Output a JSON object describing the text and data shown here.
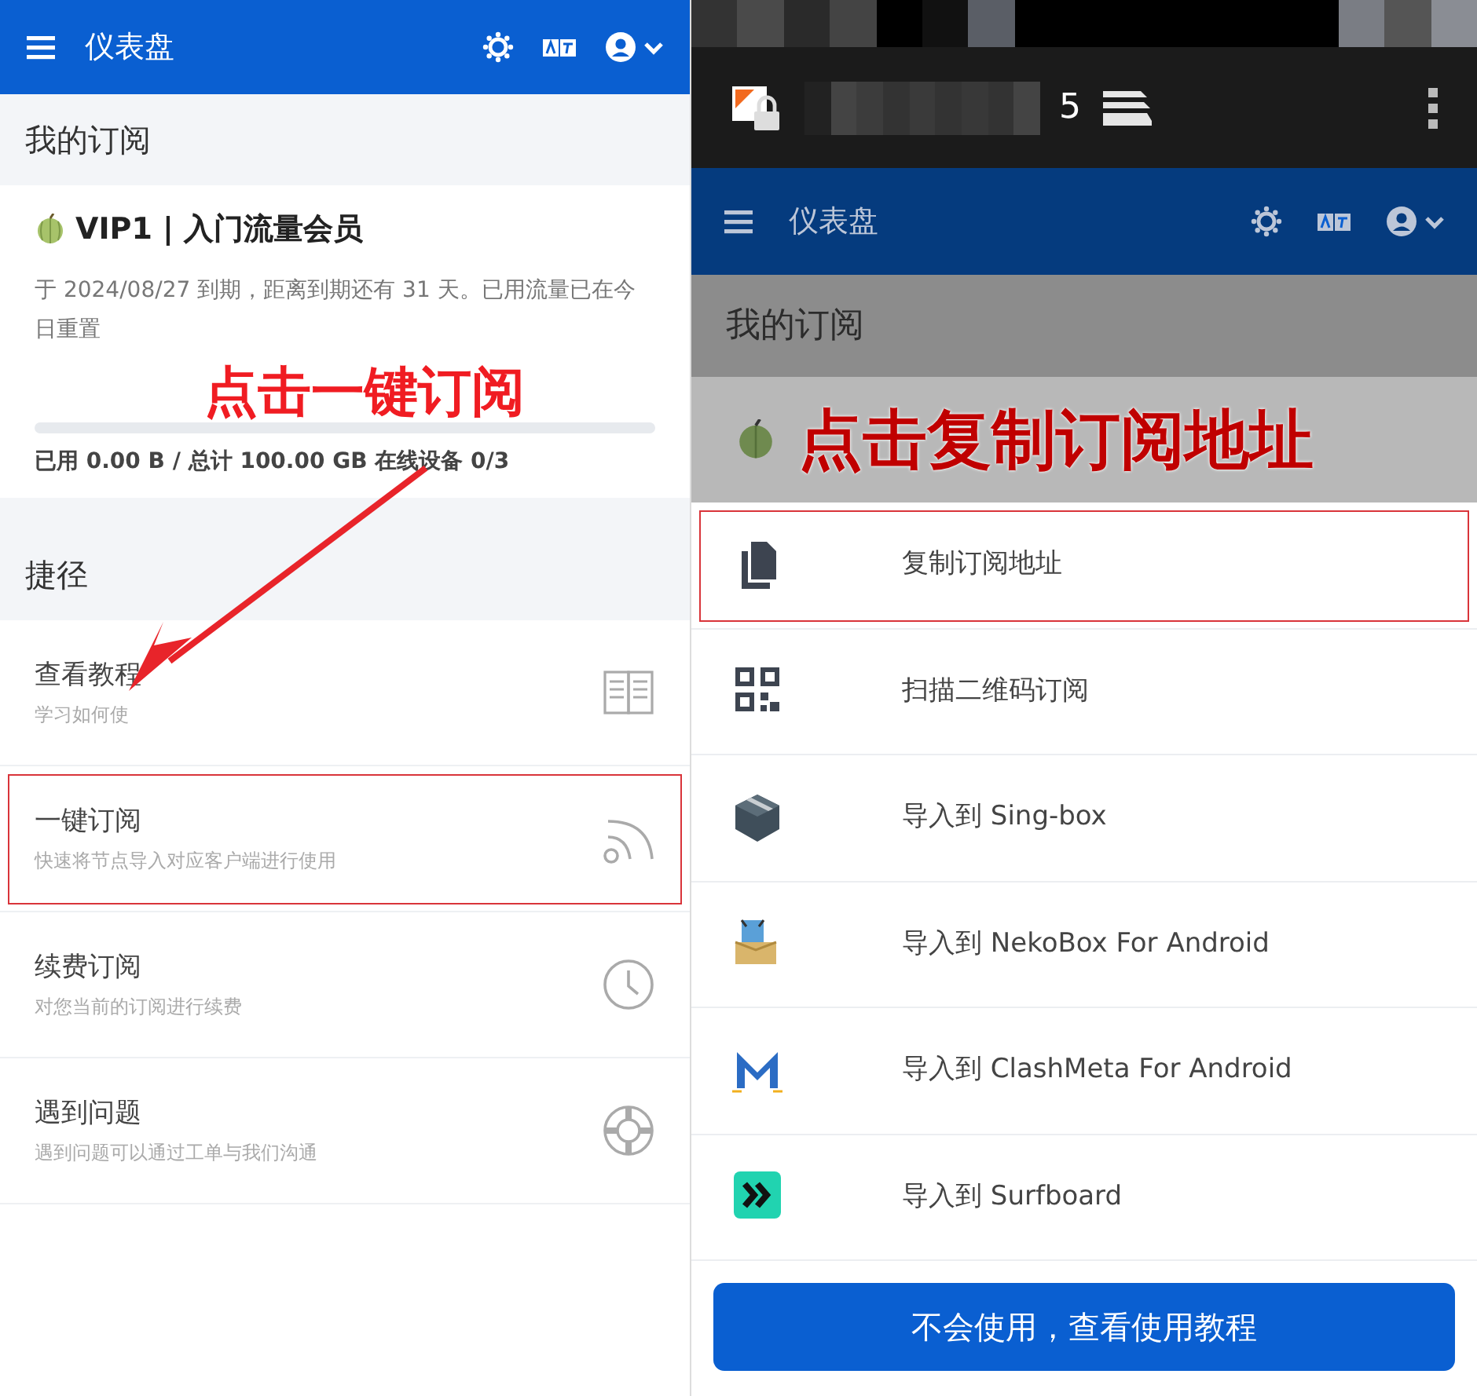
{
  "left_screen": {
    "navbar": {
      "title": "仪表盘"
    },
    "subscription": {
      "header": "我的订阅",
      "plan": "VIP1 | 入门流量会员",
      "description": "于 2024/08/27 到期，距离到期还有 31 天。已用流量已在今日重置",
      "usage": {
        "level": 0
      },
      "stats": "已用 0.00 B / 总计 100.00 GB 在线设备 0/3"
    },
    "shortcuts": {
      "header": "捷径",
      "items": [
        {
          "title": "查看教程",
          "subtitle": "学习如何使",
          "highlighted": false
        },
        {
          "title": "一键订阅",
          "subtitle": "快速将节点导入对应客户端进行使用",
          "highlighted": true
        },
        {
          "title": "续费订阅",
          "subtitle": "对您当前的订阅进行续费",
          "highlighted": false
        },
        {
          "title": "遇到问题",
          "subtitle": "遇到问题可以通过工单与我们沟通",
          "highlighted": false
        }
      ]
    },
    "annotation": "点击一键订阅"
  },
  "right_screen": {
    "browser": {
      "tab_count": "5"
    },
    "navbar": {
      "title": "仪表盘"
    },
    "subscription": {
      "header": "我的订阅"
    },
    "annotation": "点击复制订阅地址",
    "sheet": {
      "items": [
        {
          "label": "复制订阅地址",
          "highlighted": true
        },
        {
          "label": "扫描二维码订阅",
          "highlighted": false
        },
        {
          "label": "导入到 Sing-box",
          "highlighted": false
        },
        {
          "label": "导入到 NekoBox For Android",
          "highlighted": false
        },
        {
          "label": "导入到 ClashMeta For Android",
          "highlighted": false
        },
        {
          "label": "导入到 Surfboard",
          "highlighted": false
        }
      ],
      "button": "不会使用，查看使用教程"
    }
  }
}
